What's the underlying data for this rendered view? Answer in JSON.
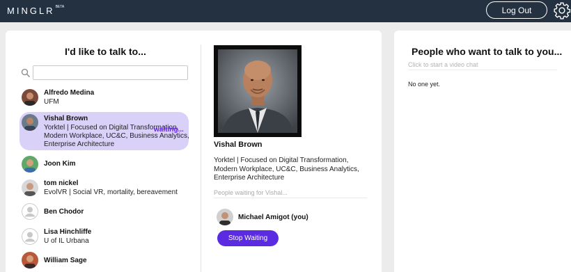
{
  "header": {
    "logo": "MINGLR",
    "beta": "BETA",
    "logout_label": "Log Out"
  },
  "left_panel": {
    "title": "I'd like to talk to...",
    "search": {
      "value": "",
      "placeholder": ""
    },
    "users": [
      {
        "name": "Alfredo Medina",
        "subtitle": [
          "UFM"
        ]
      },
      {
        "name": "Vishal Brown",
        "subtitle": [
          "Yorktel | Focused on Digital Transformation,",
          "Modern Workplace, UC&C, Business Analytics,",
          "Enterprise Architecture"
        ],
        "status": "waiting..."
      },
      {
        "name": "Joon Kim",
        "subtitle": []
      },
      {
        "name": "tom nickel",
        "subtitle": [
          "EvolVR | Social VR, mortality, bereavement"
        ]
      },
      {
        "name": "Ben Chodor",
        "subtitle": []
      },
      {
        "name": "Lisa Hinchliffe",
        "subtitle": [
          "U of IL Urbana"
        ]
      },
      {
        "name": "William Sage",
        "subtitle": []
      }
    ]
  },
  "detail": {
    "name": "Vishal Brown",
    "description": "Yorktel | Focused on Digital Transformation, Modern Workplace, UC&C, Business Analytics, Enterprise Architecture",
    "waiting_label": "People waiting for Vishal...",
    "waiting_user": "Michael Amigot (you)",
    "stop_label": "Stop Waiting"
  },
  "right_panel": {
    "title": "People who want to talk to you...",
    "hint": "Click to start a video chat",
    "empty": "No one yet."
  },
  "colors": {
    "topbar": "#233140",
    "accent": "#5a2be0",
    "selected_bg": "#d9d1f8",
    "waiting_text": "#6a2ae8"
  },
  "icons": [
    "search-icon",
    "gear-icon",
    "avatar-placeholder-icon"
  ]
}
